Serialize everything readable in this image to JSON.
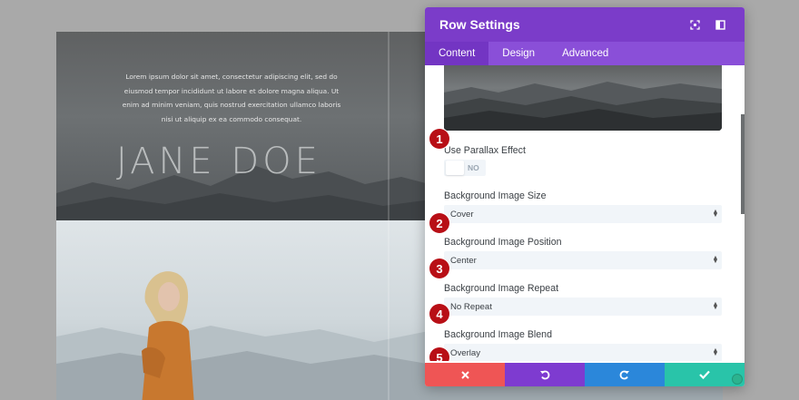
{
  "preview": {
    "hero_text": "Lorem ipsum dolor sit amet, consectetur adipiscing elit, sed do eiusmod tempor incididunt ut labore et dolore magna aliqua. Ut enim ad minim veniam, quis nostrud exercitation ullamco laboris nisi ut aliquip ex ea commodo consequat.",
    "hero_title": "JANE DOE"
  },
  "modal": {
    "title": "Row Settings",
    "tabs": [
      {
        "label": "Content",
        "active": true
      },
      {
        "label": "Design",
        "active": false
      },
      {
        "label": "Advanced",
        "active": false
      }
    ],
    "parallax": {
      "label": "Use Parallax Effect",
      "toggle_value": "NO"
    },
    "fields": [
      {
        "label": "Background Image Size",
        "value": "Cover"
      },
      {
        "label": "Background Image Position",
        "value": "Center"
      },
      {
        "label": "Background Image Repeat",
        "value": "No Repeat"
      },
      {
        "label": "Background Image Blend",
        "value": "Overlay"
      }
    ],
    "badges": [
      "1",
      "2",
      "3",
      "4",
      "5"
    ],
    "footer_icons": [
      "close-icon",
      "undo-icon",
      "redo-icon",
      "check-icon"
    ]
  },
  "colors": {
    "header": "#7b3cc9",
    "tabs": "#8a4fd8",
    "badge": "#b80f16",
    "cancel": "#ef5555",
    "undo": "#7e3bd0",
    "redo": "#2b87da",
    "save": "#29c4a9"
  }
}
